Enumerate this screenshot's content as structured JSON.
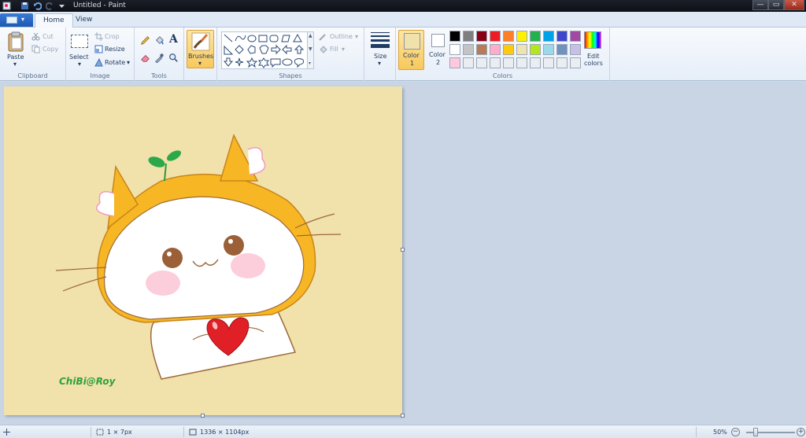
{
  "window": {
    "title": "Untitled - Paint",
    "controls": {
      "minimize": "—",
      "maximize": "▭",
      "close": "✕"
    }
  },
  "tabs": {
    "home": "Home",
    "view": "View"
  },
  "ribbon": {
    "clipboard": {
      "label": "Clipboard",
      "paste": "Paste",
      "cut": "Cut",
      "copy": "Copy"
    },
    "image": {
      "label": "Image",
      "select": "Select",
      "crop": "Crop",
      "resize": "Resize",
      "rotate": "Rotate"
    },
    "tools": {
      "label": "Tools"
    },
    "brushes": {
      "label": "Brushes"
    },
    "shapes": {
      "label": "Shapes",
      "outline": "Outline",
      "fill": "Fill"
    },
    "size": {
      "label": "Size"
    },
    "colors": {
      "label": "Colors",
      "color1_label": "Color",
      "color1_num": "1",
      "color1_value": "#f1e1ab",
      "color2_label": "Color",
      "color2_num": "2",
      "color2_value": "#ffffff",
      "edit_label": "Edit",
      "edit_label2": "colors",
      "palette_row1": [
        "#000000",
        "#7f7f7f",
        "#880015",
        "#ed1c24",
        "#ff7f27",
        "#fff200",
        "#22b14c",
        "#00a2e8",
        "#3f48cc",
        "#a349a4"
      ],
      "palette_row2": [
        "#ffffff",
        "#c3c3c3",
        "#b97a57",
        "#ffaec9",
        "#ffc90e",
        "#efe4b0",
        "#b5e61d",
        "#99d9ea",
        "#7092be",
        "#c8bfe7"
      ],
      "palette_row3": [
        "#ffc8dc",
        "#eaeef3",
        "#eaeef3",
        "#eaeef3",
        "#eaeef3",
        "#eaeef3",
        "#eaeef3",
        "#eaeef3",
        "#eaeef3",
        "#eaeef3"
      ]
    }
  },
  "canvas": {
    "background": "#f1e1ab",
    "artwork": "cat-character-with-heart",
    "signature": "ChiBi@Roy"
  },
  "statusbar": {
    "selection_size": "1 × 7px",
    "image_size": "1336 × 1104px",
    "zoom": "50%",
    "zoom_fraction": 0.2
  }
}
